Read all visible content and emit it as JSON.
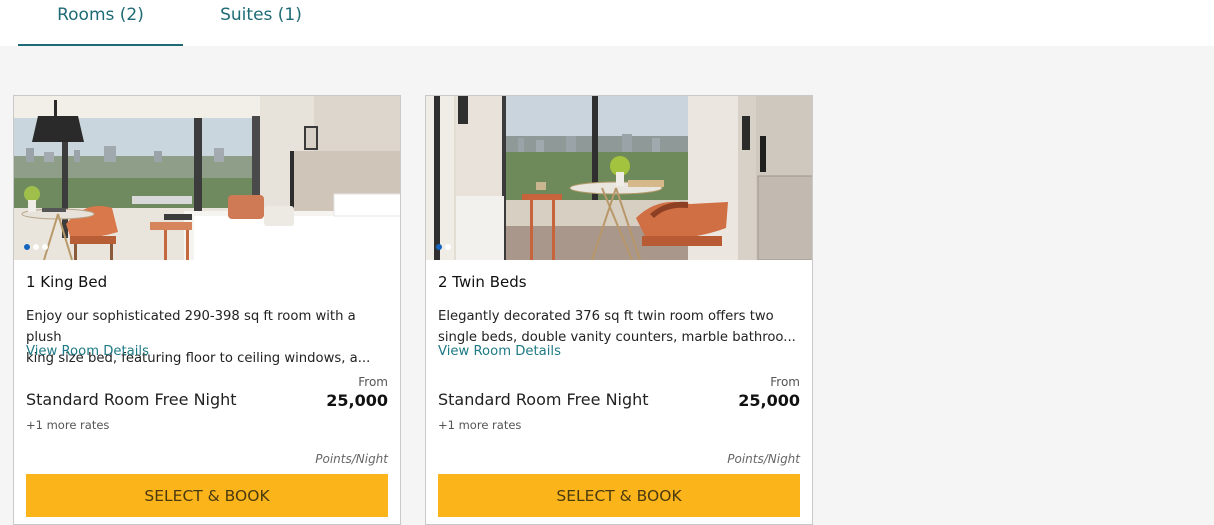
{
  "tabs": [
    {
      "label": "Rooms (2)",
      "active": true
    },
    {
      "label": "Suites (1)",
      "active": false
    }
  ],
  "colors": {
    "accent": "#1e6b75",
    "link": "#1e7a85",
    "book_button": "#fbb41a",
    "carousel_active_dot": "#1565c0"
  },
  "rooms": [
    {
      "title": "1 King Bed",
      "description_line1": "Enjoy our sophisticated 290-398 sq ft room with a plush",
      "description_line2": "king size bed, featuring floor to ceiling windows, a...",
      "details_link": "View Room Details",
      "from_label": "From",
      "rate_name": "Standard Room Free Night",
      "points": "25,000",
      "more_rates": "+1 more rates",
      "per_night": "Points/Night",
      "button_label": "SELECT & BOOK",
      "carousel": {
        "count": 3,
        "active": 1
      }
    },
    {
      "title": "2 Twin Beds",
      "description_line1": "Elegantly decorated 376 sq ft twin room offers two",
      "description_line2": "single beds, double vanity counters, marble bathroo...",
      "details_link": "View Room Details",
      "from_label": "From",
      "rate_name": "Standard Room Free Night",
      "points": "25,000",
      "more_rates": "+1 more rates",
      "per_night": "Points/Night",
      "button_label": "SELECT & BOOK",
      "carousel": {
        "count": 2,
        "active": 1
      }
    }
  ]
}
